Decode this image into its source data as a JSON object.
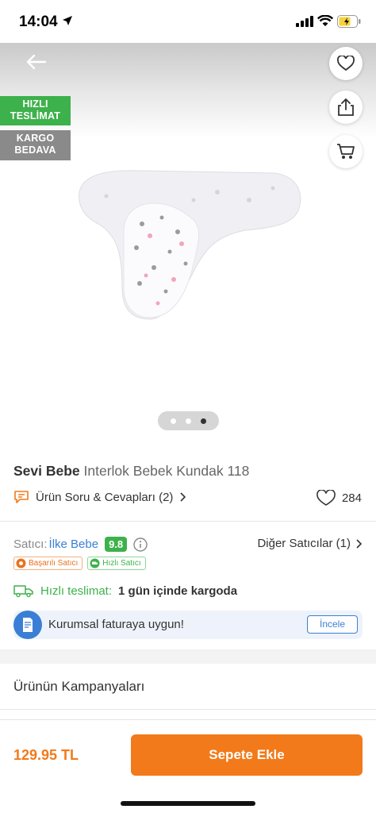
{
  "status": {
    "time": "14:04"
  },
  "badges": {
    "fast_delivery": "HIZLI TESLİMAT",
    "free_shipping": "KARGO BEDAVA"
  },
  "icons": {
    "back": "arrow-left-icon",
    "favorite": "heart-icon",
    "share": "share-icon",
    "cart": "cart-icon",
    "qa": "chat-icon",
    "truck": "truck-icon",
    "invoice": "invoice-icon",
    "info": "info-icon"
  },
  "product": {
    "brand": "Sevi Bebe",
    "name": "Interlok Bebek Kundak 118",
    "qa_label": "Ürün Soru & Cevapları (2)",
    "likes": "284",
    "image_index": 3,
    "image_count": 3
  },
  "seller": {
    "label": "Satıcı:",
    "name": "İlke Bebe",
    "score": "9.8",
    "other_sellers": "Diğer Satıcılar (1)",
    "tags": [
      "Başarılı Satıcı",
      "Hızlı Satıcı"
    ]
  },
  "delivery": {
    "label": "Hızlı teslimat:",
    "value": "1 gün içinde kargoda"
  },
  "invoice": {
    "text": "Kurumsal faturaya uygun!",
    "button": "İncele"
  },
  "campaigns": {
    "title": "Ürünün Kampanyaları"
  },
  "footer": {
    "price": "129.95 TL",
    "add_to_cart": "Sepete Ekle"
  },
  "colors": {
    "accent": "#f27a1a",
    "green": "#3db14b",
    "blue": "#3a7fd5"
  }
}
